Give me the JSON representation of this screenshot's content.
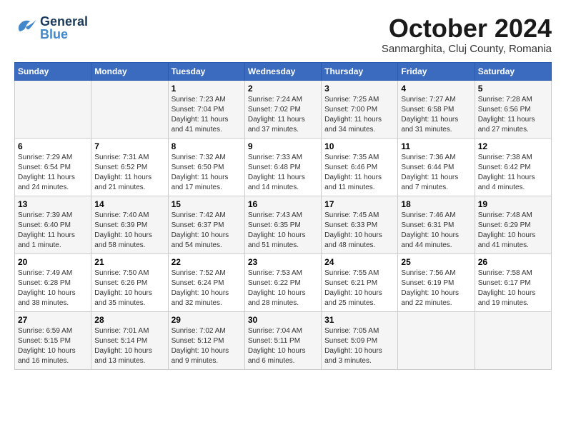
{
  "header": {
    "logo_general": "General",
    "logo_blue": "Blue",
    "month": "October 2024",
    "location": "Sanmarghita, Cluj County, Romania"
  },
  "days_of_week": [
    "Sunday",
    "Monday",
    "Tuesday",
    "Wednesday",
    "Thursday",
    "Friday",
    "Saturday"
  ],
  "weeks": [
    [
      {
        "num": "",
        "info": ""
      },
      {
        "num": "",
        "info": ""
      },
      {
        "num": "1",
        "info": "Sunrise: 7:23 AM\nSunset: 7:04 PM\nDaylight: 11 hours and 41 minutes."
      },
      {
        "num": "2",
        "info": "Sunrise: 7:24 AM\nSunset: 7:02 PM\nDaylight: 11 hours and 37 minutes."
      },
      {
        "num": "3",
        "info": "Sunrise: 7:25 AM\nSunset: 7:00 PM\nDaylight: 11 hours and 34 minutes."
      },
      {
        "num": "4",
        "info": "Sunrise: 7:27 AM\nSunset: 6:58 PM\nDaylight: 11 hours and 31 minutes."
      },
      {
        "num": "5",
        "info": "Sunrise: 7:28 AM\nSunset: 6:56 PM\nDaylight: 11 hours and 27 minutes."
      }
    ],
    [
      {
        "num": "6",
        "info": "Sunrise: 7:29 AM\nSunset: 6:54 PM\nDaylight: 11 hours and 24 minutes."
      },
      {
        "num": "7",
        "info": "Sunrise: 7:31 AM\nSunset: 6:52 PM\nDaylight: 11 hours and 21 minutes."
      },
      {
        "num": "8",
        "info": "Sunrise: 7:32 AM\nSunset: 6:50 PM\nDaylight: 11 hours and 17 minutes."
      },
      {
        "num": "9",
        "info": "Sunrise: 7:33 AM\nSunset: 6:48 PM\nDaylight: 11 hours and 14 minutes."
      },
      {
        "num": "10",
        "info": "Sunrise: 7:35 AM\nSunset: 6:46 PM\nDaylight: 11 hours and 11 minutes."
      },
      {
        "num": "11",
        "info": "Sunrise: 7:36 AM\nSunset: 6:44 PM\nDaylight: 11 hours and 7 minutes."
      },
      {
        "num": "12",
        "info": "Sunrise: 7:38 AM\nSunset: 6:42 PM\nDaylight: 11 hours and 4 minutes."
      }
    ],
    [
      {
        "num": "13",
        "info": "Sunrise: 7:39 AM\nSunset: 6:40 PM\nDaylight: 11 hours and 1 minute."
      },
      {
        "num": "14",
        "info": "Sunrise: 7:40 AM\nSunset: 6:39 PM\nDaylight: 10 hours and 58 minutes."
      },
      {
        "num": "15",
        "info": "Sunrise: 7:42 AM\nSunset: 6:37 PM\nDaylight: 10 hours and 54 minutes."
      },
      {
        "num": "16",
        "info": "Sunrise: 7:43 AM\nSunset: 6:35 PM\nDaylight: 10 hours and 51 minutes."
      },
      {
        "num": "17",
        "info": "Sunrise: 7:45 AM\nSunset: 6:33 PM\nDaylight: 10 hours and 48 minutes."
      },
      {
        "num": "18",
        "info": "Sunrise: 7:46 AM\nSunset: 6:31 PM\nDaylight: 10 hours and 44 minutes."
      },
      {
        "num": "19",
        "info": "Sunrise: 7:48 AM\nSunset: 6:29 PM\nDaylight: 10 hours and 41 minutes."
      }
    ],
    [
      {
        "num": "20",
        "info": "Sunrise: 7:49 AM\nSunset: 6:28 PM\nDaylight: 10 hours and 38 minutes."
      },
      {
        "num": "21",
        "info": "Sunrise: 7:50 AM\nSunset: 6:26 PM\nDaylight: 10 hours and 35 minutes."
      },
      {
        "num": "22",
        "info": "Sunrise: 7:52 AM\nSunset: 6:24 PM\nDaylight: 10 hours and 32 minutes."
      },
      {
        "num": "23",
        "info": "Sunrise: 7:53 AM\nSunset: 6:22 PM\nDaylight: 10 hours and 28 minutes."
      },
      {
        "num": "24",
        "info": "Sunrise: 7:55 AM\nSunset: 6:21 PM\nDaylight: 10 hours and 25 minutes."
      },
      {
        "num": "25",
        "info": "Sunrise: 7:56 AM\nSunset: 6:19 PM\nDaylight: 10 hours and 22 minutes."
      },
      {
        "num": "26",
        "info": "Sunrise: 7:58 AM\nSunset: 6:17 PM\nDaylight: 10 hours and 19 minutes."
      }
    ],
    [
      {
        "num": "27",
        "info": "Sunrise: 6:59 AM\nSunset: 5:15 PM\nDaylight: 10 hours and 16 minutes."
      },
      {
        "num": "28",
        "info": "Sunrise: 7:01 AM\nSunset: 5:14 PM\nDaylight: 10 hours and 13 minutes."
      },
      {
        "num": "29",
        "info": "Sunrise: 7:02 AM\nSunset: 5:12 PM\nDaylight: 10 hours and 9 minutes."
      },
      {
        "num": "30",
        "info": "Sunrise: 7:04 AM\nSunset: 5:11 PM\nDaylight: 10 hours and 6 minutes."
      },
      {
        "num": "31",
        "info": "Sunrise: 7:05 AM\nSunset: 5:09 PM\nDaylight: 10 hours and 3 minutes."
      },
      {
        "num": "",
        "info": ""
      },
      {
        "num": "",
        "info": ""
      }
    ]
  ]
}
